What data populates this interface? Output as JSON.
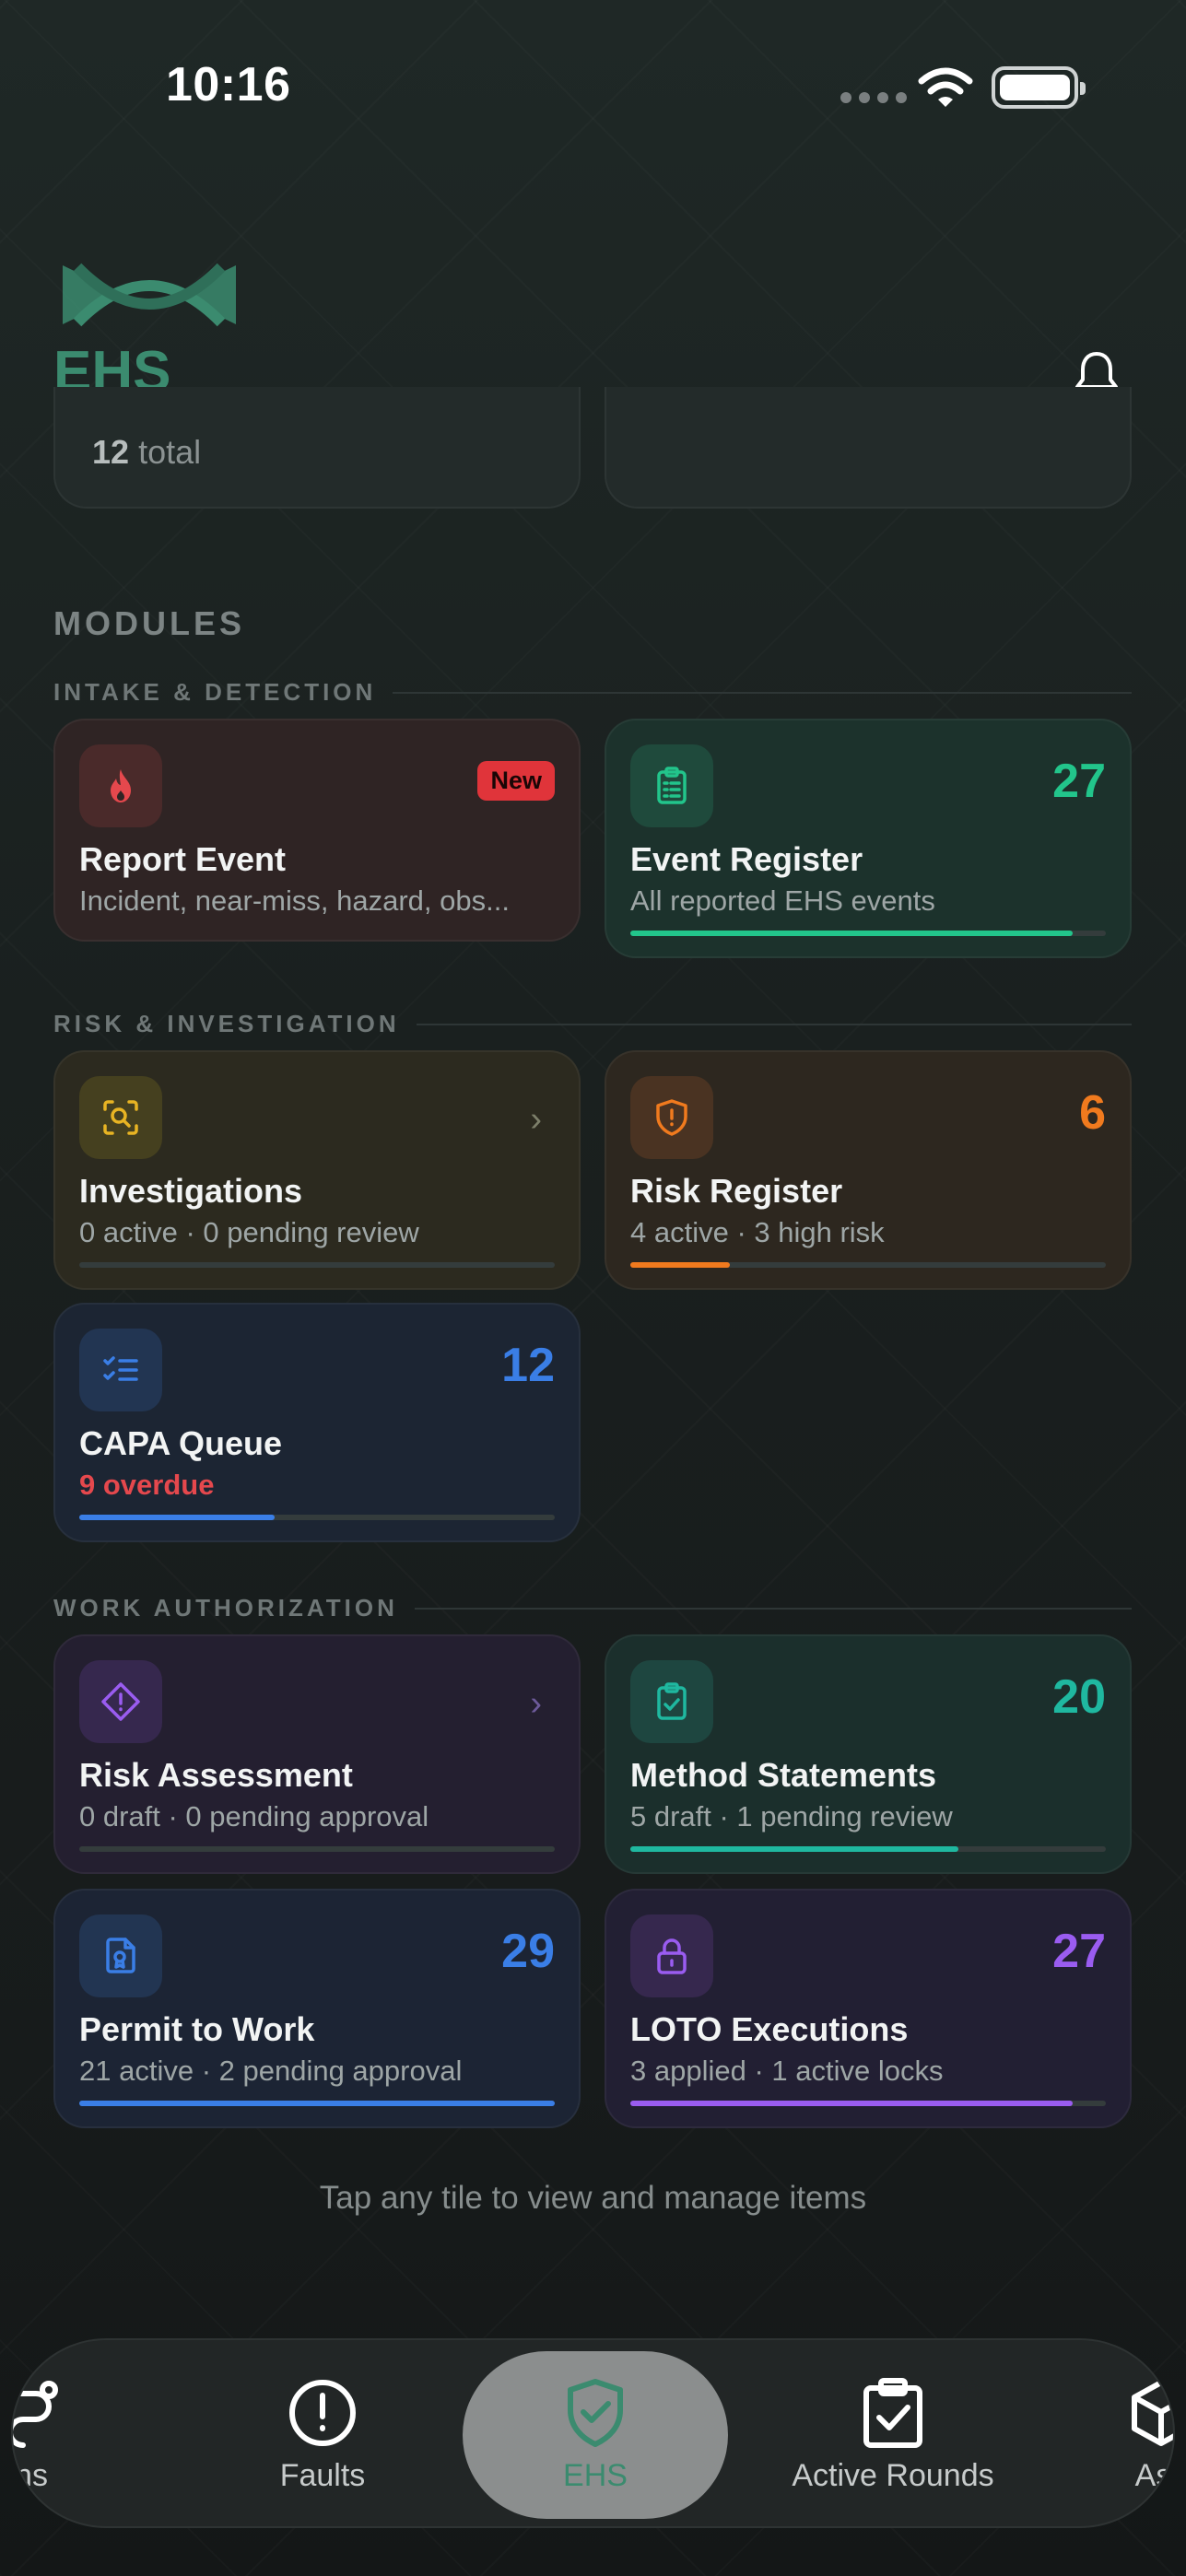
{
  "status": {
    "time": "10:16"
  },
  "header": {
    "brand": "EHS"
  },
  "summary": {
    "left_count": "12",
    "left_suffix": "total"
  },
  "modules_title": "MODULES",
  "sections": {
    "intake": "INTAKE & DETECTION",
    "risk": "RISK & INVESTIGATION",
    "work": "WORK AUTHORIZATION"
  },
  "tiles": {
    "report_event": {
      "title": "Report Event",
      "subtitle": "Incident, near-miss, hazard, obs...",
      "badge": "New",
      "icon": "flame-icon",
      "color": "#e5484d"
    },
    "event_register": {
      "title": "Event Register",
      "subtitle": "All reported EHS events",
      "count": "27",
      "progress": 0.93,
      "icon": "clipboard-list-icon",
      "color": "#22c58b"
    },
    "investigations": {
      "title": "Investigations",
      "subtitle": "0 active · 0 pending review",
      "progress": 0,
      "icon": "scan-search-icon",
      "color": "#e8b423"
    },
    "risk_register": {
      "title": "Risk Register",
      "subtitle": "4 active · 3 high risk",
      "count": "6",
      "progress": 0.21,
      "icon": "shield-alert-icon",
      "color": "#f07a1e"
    },
    "capa_queue": {
      "title": "CAPA Queue",
      "subtitle": "9 overdue",
      "count": "12",
      "progress": 0.41,
      "icon": "list-checks-icon",
      "color": "#3a7ee6"
    },
    "risk_assessment": {
      "title": "Risk Assessment",
      "subtitle": "0 draft · 0 pending approval",
      "progress": 0,
      "icon": "diamond-alert-icon",
      "color": "#9a5cf0"
    },
    "method_statements": {
      "title": "Method Statements",
      "subtitle": "5 draft · 1 pending review",
      "count": "20",
      "progress": 0.69,
      "icon": "clipboard-check-icon",
      "color": "#1fb8a0"
    },
    "permit_to_work": {
      "title": "Permit to Work",
      "subtitle": "21 active · 2 pending approval",
      "count": "29",
      "progress": 1.0,
      "icon": "file-badge-icon",
      "color": "#3a7ee6"
    },
    "loto_executions": {
      "title": "LOTO Executions",
      "subtitle": "3 applied · 1 active locks",
      "count": "27",
      "progress": 0.93,
      "icon": "lock-icon",
      "color": "#9a5cf0"
    }
  },
  "hint": "Tap any tile to view and manage items",
  "nav": {
    "items": [
      {
        "label": "ns",
        "icon": "rounds-icon"
      },
      {
        "label": "Faults",
        "icon": "alert-circle-icon"
      },
      {
        "label": "EHS",
        "icon": "shield-check-icon",
        "active": true
      },
      {
        "label": "Active Rounds",
        "icon": "clipboard-check-icon"
      },
      {
        "label": "Ass",
        "icon": "cube-icon"
      }
    ]
  }
}
